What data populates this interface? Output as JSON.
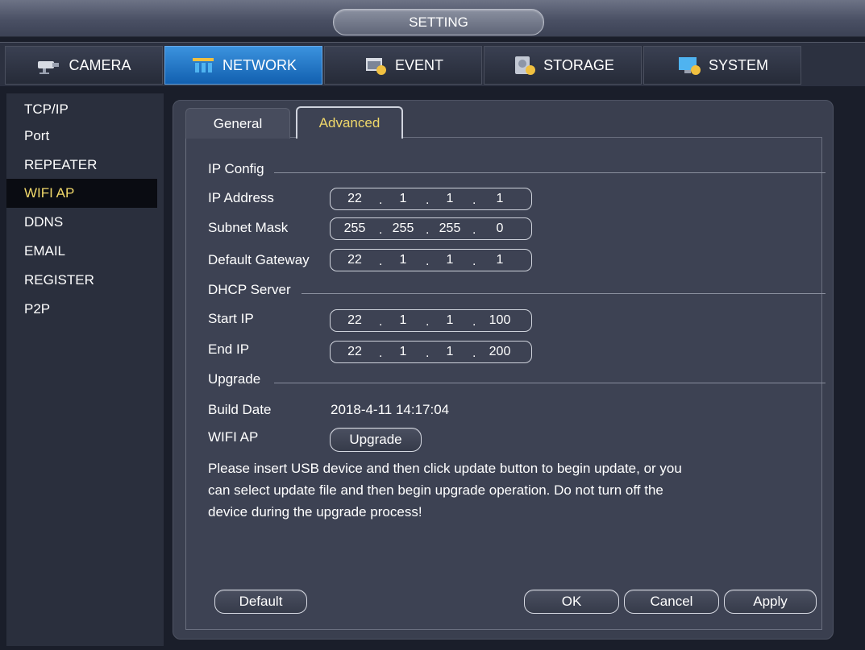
{
  "window": {
    "title": "SETTING"
  },
  "topnav": {
    "tabs": [
      {
        "label": "CAMERA",
        "icon": "camera-icon",
        "active": false
      },
      {
        "label": "NETWORK",
        "icon": "network-icon",
        "active": true
      },
      {
        "label": "EVENT",
        "icon": "event-icon",
        "active": false
      },
      {
        "label": "STORAGE",
        "icon": "storage-icon",
        "active": false
      },
      {
        "label": "SYSTEM",
        "icon": "system-icon",
        "active": false
      }
    ]
  },
  "sidebar": {
    "items": [
      {
        "label": "TCP/IP"
      },
      {
        "label": "Port"
      },
      {
        "label": "REPEATER"
      },
      {
        "label": "WIFI AP",
        "active": true
      },
      {
        "label": "DDNS"
      },
      {
        "label": "EMAIL"
      },
      {
        "label": "REGISTER"
      },
      {
        "label": "P2P"
      }
    ]
  },
  "tabs": {
    "general": "General",
    "advanced": "Advanced"
  },
  "ip_config": {
    "title": "IP Config",
    "ip_address": {
      "label": "IP Address",
      "octets": [
        "22",
        "1",
        "1",
        "1"
      ]
    },
    "subnet_mask": {
      "label": "Subnet Mask",
      "octets": [
        "255",
        "255",
        "255",
        "0"
      ]
    },
    "default_gateway": {
      "label": "Default Gateway",
      "octets": [
        "22",
        "1",
        "1",
        "1"
      ]
    }
  },
  "dhcp": {
    "title": "DHCP Server",
    "start_ip": {
      "label": "Start IP",
      "octets": [
        "22",
        "1",
        "1",
        "100"
      ]
    },
    "end_ip": {
      "label": "End IP",
      "octets": [
        "22",
        "1",
        "1",
        "200"
      ]
    }
  },
  "upgrade": {
    "title": "Upgrade",
    "build_date_label": "Build Date",
    "build_date_value": "2018-4-11 14:17:04",
    "wifi_ap_label": "WIFI AP",
    "upgrade_button": "Upgrade",
    "notice_line1": "Please insert USB device and then click update button to begin update, or you",
    "notice_line2": "can select update file and then begin upgrade operation. Do not turn off the",
    "notice_line3": "device during the upgrade process!"
  },
  "buttons": {
    "default": "Default",
    "ok": "OK",
    "cancel": "Cancel",
    "apply": "Apply"
  },
  "colors": {
    "accent_active_tab": "#1a6cc4",
    "highlight_text": "#f0d86a",
    "panel_bg": "#3d4253"
  }
}
